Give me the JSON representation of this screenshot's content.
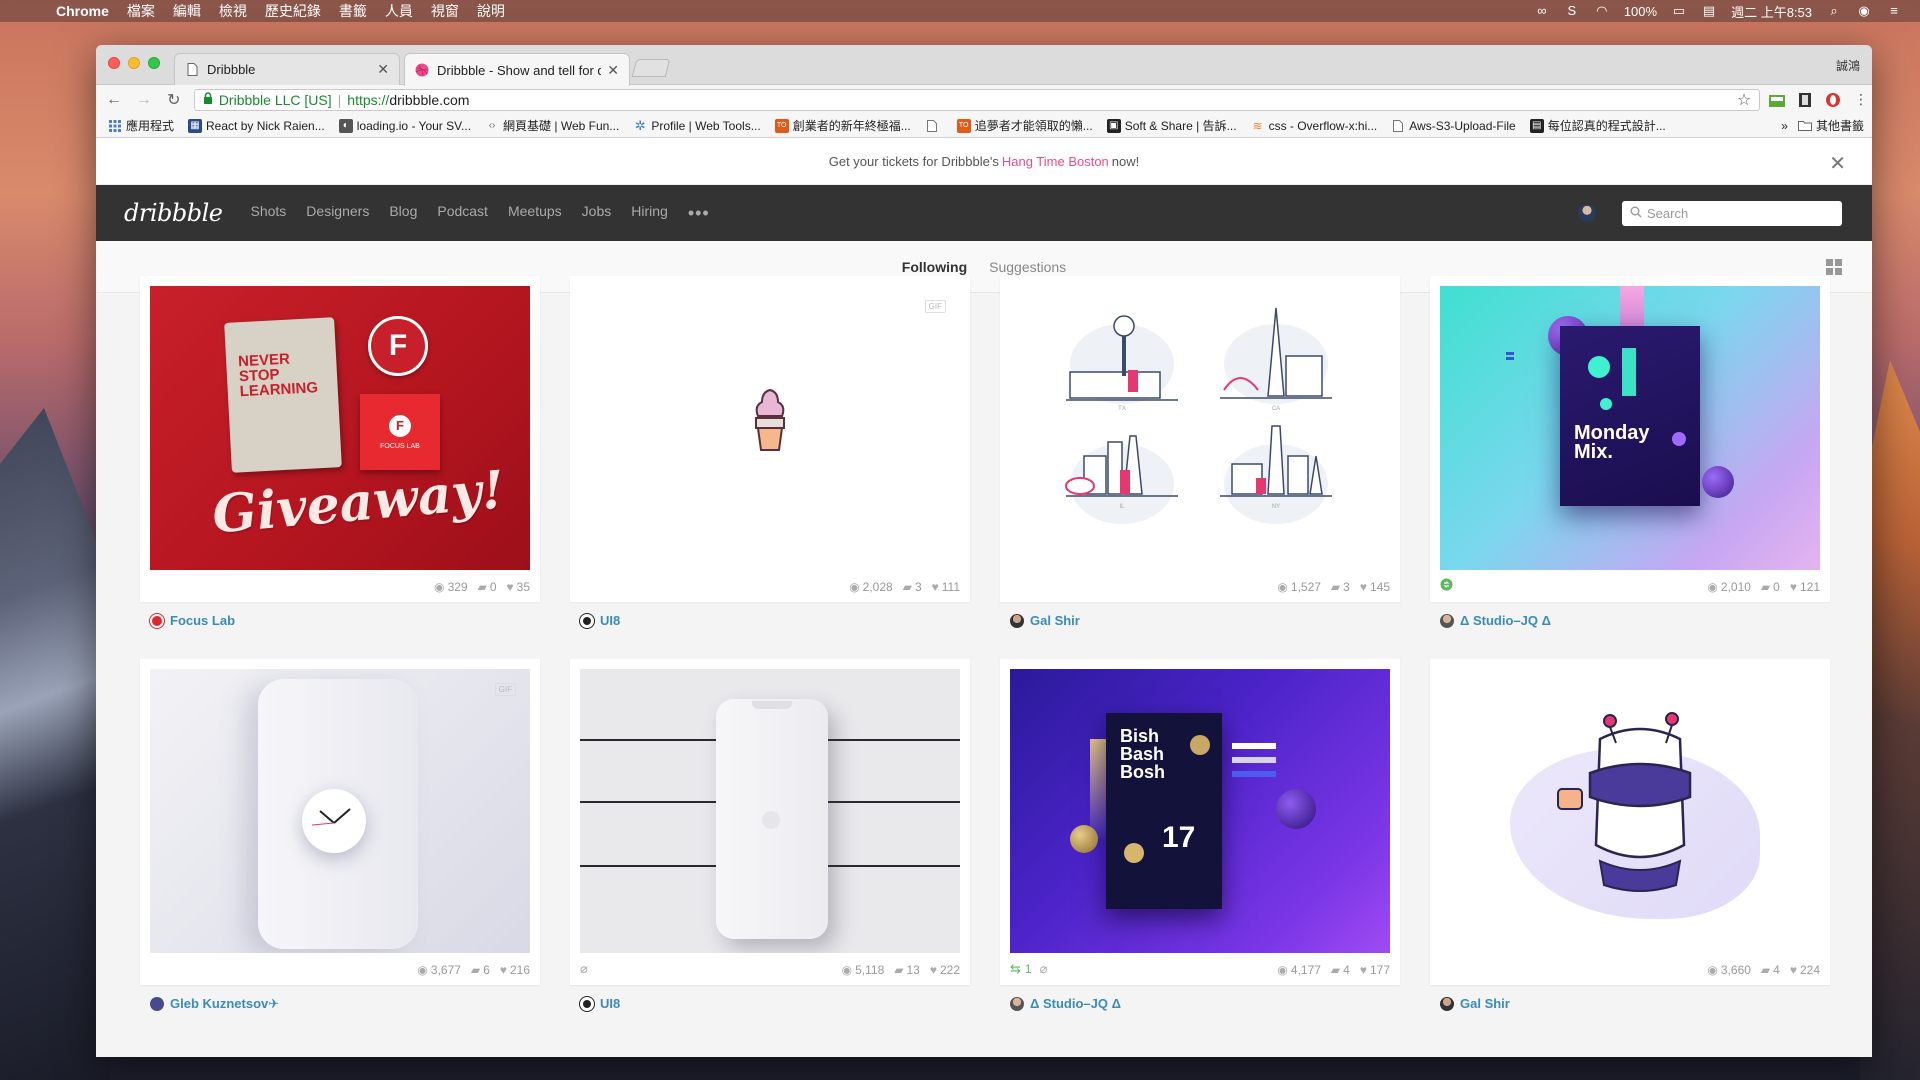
{
  "menubar": {
    "app": "Chrome",
    "items": [
      "檔案",
      "編輯",
      "檢視",
      "歷史紀錄",
      "書籤",
      "人員",
      "視窗",
      "說明"
    ],
    "battery": "100%",
    "clock": "週二 上午8:53"
  },
  "browser": {
    "tabs": [
      {
        "title": "Dribbble",
        "active": false
      },
      {
        "title": "Dribbble - Show and tell for de",
        "active": true
      }
    ],
    "profile_name": "誠鴻",
    "omnibox": {
      "ev_label": "Dribbble LLC [US]",
      "url_proto": "https://",
      "url_host": "dribbble.com"
    },
    "bookmarks": [
      {
        "label": "應用程式",
        "icon": "apps-grid-icon",
        "color": "#4a7bd0"
      },
      {
        "label": "React by Nick Raien...",
        "icon": "bookmark-react-icon",
        "color": "#2c4a8a"
      },
      {
        "label": "loading.io - Your SV...",
        "icon": "bookmark-loading-icon",
        "color": "#555555"
      },
      {
        "label": "網頁基礎 | Web Fun...",
        "icon": "code-icon",
        "color": "#666666"
      },
      {
        "label": "Profile | Web Tools...",
        "icon": "gear-icon",
        "color": "#3b7ddd"
      },
      {
        "label": "創業者的新年終極福...",
        "icon": "bookmark-to-icon",
        "color": "#e05a1a"
      },
      {
        "label": "",
        "icon": "page-icon",
        "color": "#888888"
      },
      {
        "label": "追夢者才能領取的懶...",
        "icon": "bookmark-to-icon",
        "color": "#e05a1a"
      },
      {
        "label": "Soft & Share | 告訴...",
        "icon": "bookmark-soft-icon",
        "color": "#222222"
      },
      {
        "label": "css - Overflow-x:hi...",
        "icon": "stackoverflow-icon",
        "color": "#f48024"
      },
      {
        "label": "Aws-S3-Upload-File",
        "icon": "page-icon",
        "color": "#888888"
      },
      {
        "label": "每位認真的程式設計...",
        "icon": "bookmark-book-icon",
        "color": "#222222"
      }
    ],
    "other_bookmarks": "其他書籤"
  },
  "promo": {
    "prefix": "Get your tickets for Dribbble's",
    "highlight": "Hang Time Boston",
    "suffix": "now!"
  },
  "nav": {
    "logo": "dribbble",
    "links": [
      "Shots",
      "Designers",
      "Blog",
      "Podcast",
      "Meetups",
      "Jobs",
      "Hiring"
    ],
    "more": "•••",
    "search_placeholder": "Search"
  },
  "subnav": {
    "following": "Following",
    "suggestions": "Suggestions"
  },
  "shots": [
    {
      "author": "Focus Lab",
      "views": "329",
      "comments": "0",
      "likes": "35",
      "gif": false,
      "thumb_text": [
        "NEVER",
        "STOP",
        "LEARNING",
        "Giveaway!",
        "FOCUS LAB"
      ]
    },
    {
      "author": "UI8",
      "views": "2,028",
      "comments": "3",
      "likes": "111",
      "gif": true,
      "gif_label": "GIF"
    },
    {
      "author": "Gal Shir",
      "views": "1,527",
      "comments": "3",
      "likes": "145",
      "gif": false,
      "thumb_text": [
        "TX",
        "CA",
        "IL",
        "NY"
      ]
    },
    {
      "author": "Δ Studio–JQ Δ",
      "views": "2,010",
      "comments": "0",
      "likes": "121",
      "gif": false,
      "rebound": "",
      "thumb_text": [
        "Monday",
        "Mix."
      ]
    },
    {
      "author": "Gleb Kuznetsov✈",
      "views": "3,677",
      "comments": "6",
      "likes": "216",
      "gif": true,
      "gif_label": "GIF"
    },
    {
      "author": "UI8",
      "views": "5,118",
      "comments": "13",
      "likes": "222",
      "gif": false
    },
    {
      "author": "Δ Studio–JQ Δ",
      "views": "4,177",
      "comments": "4",
      "likes": "177",
      "gif": false,
      "rebound": "1",
      "thumb_text": [
        "Bish",
        "Bash",
        "Bosh",
        "17"
      ]
    },
    {
      "author": "Gal Shir",
      "views": "3,660",
      "comments": "4",
      "likes": "224",
      "gif": false
    }
  ],
  "colors": {
    "accent": "#ea4c89",
    "nav_bg": "#333333",
    "author_link": "#3a8bbb"
  }
}
